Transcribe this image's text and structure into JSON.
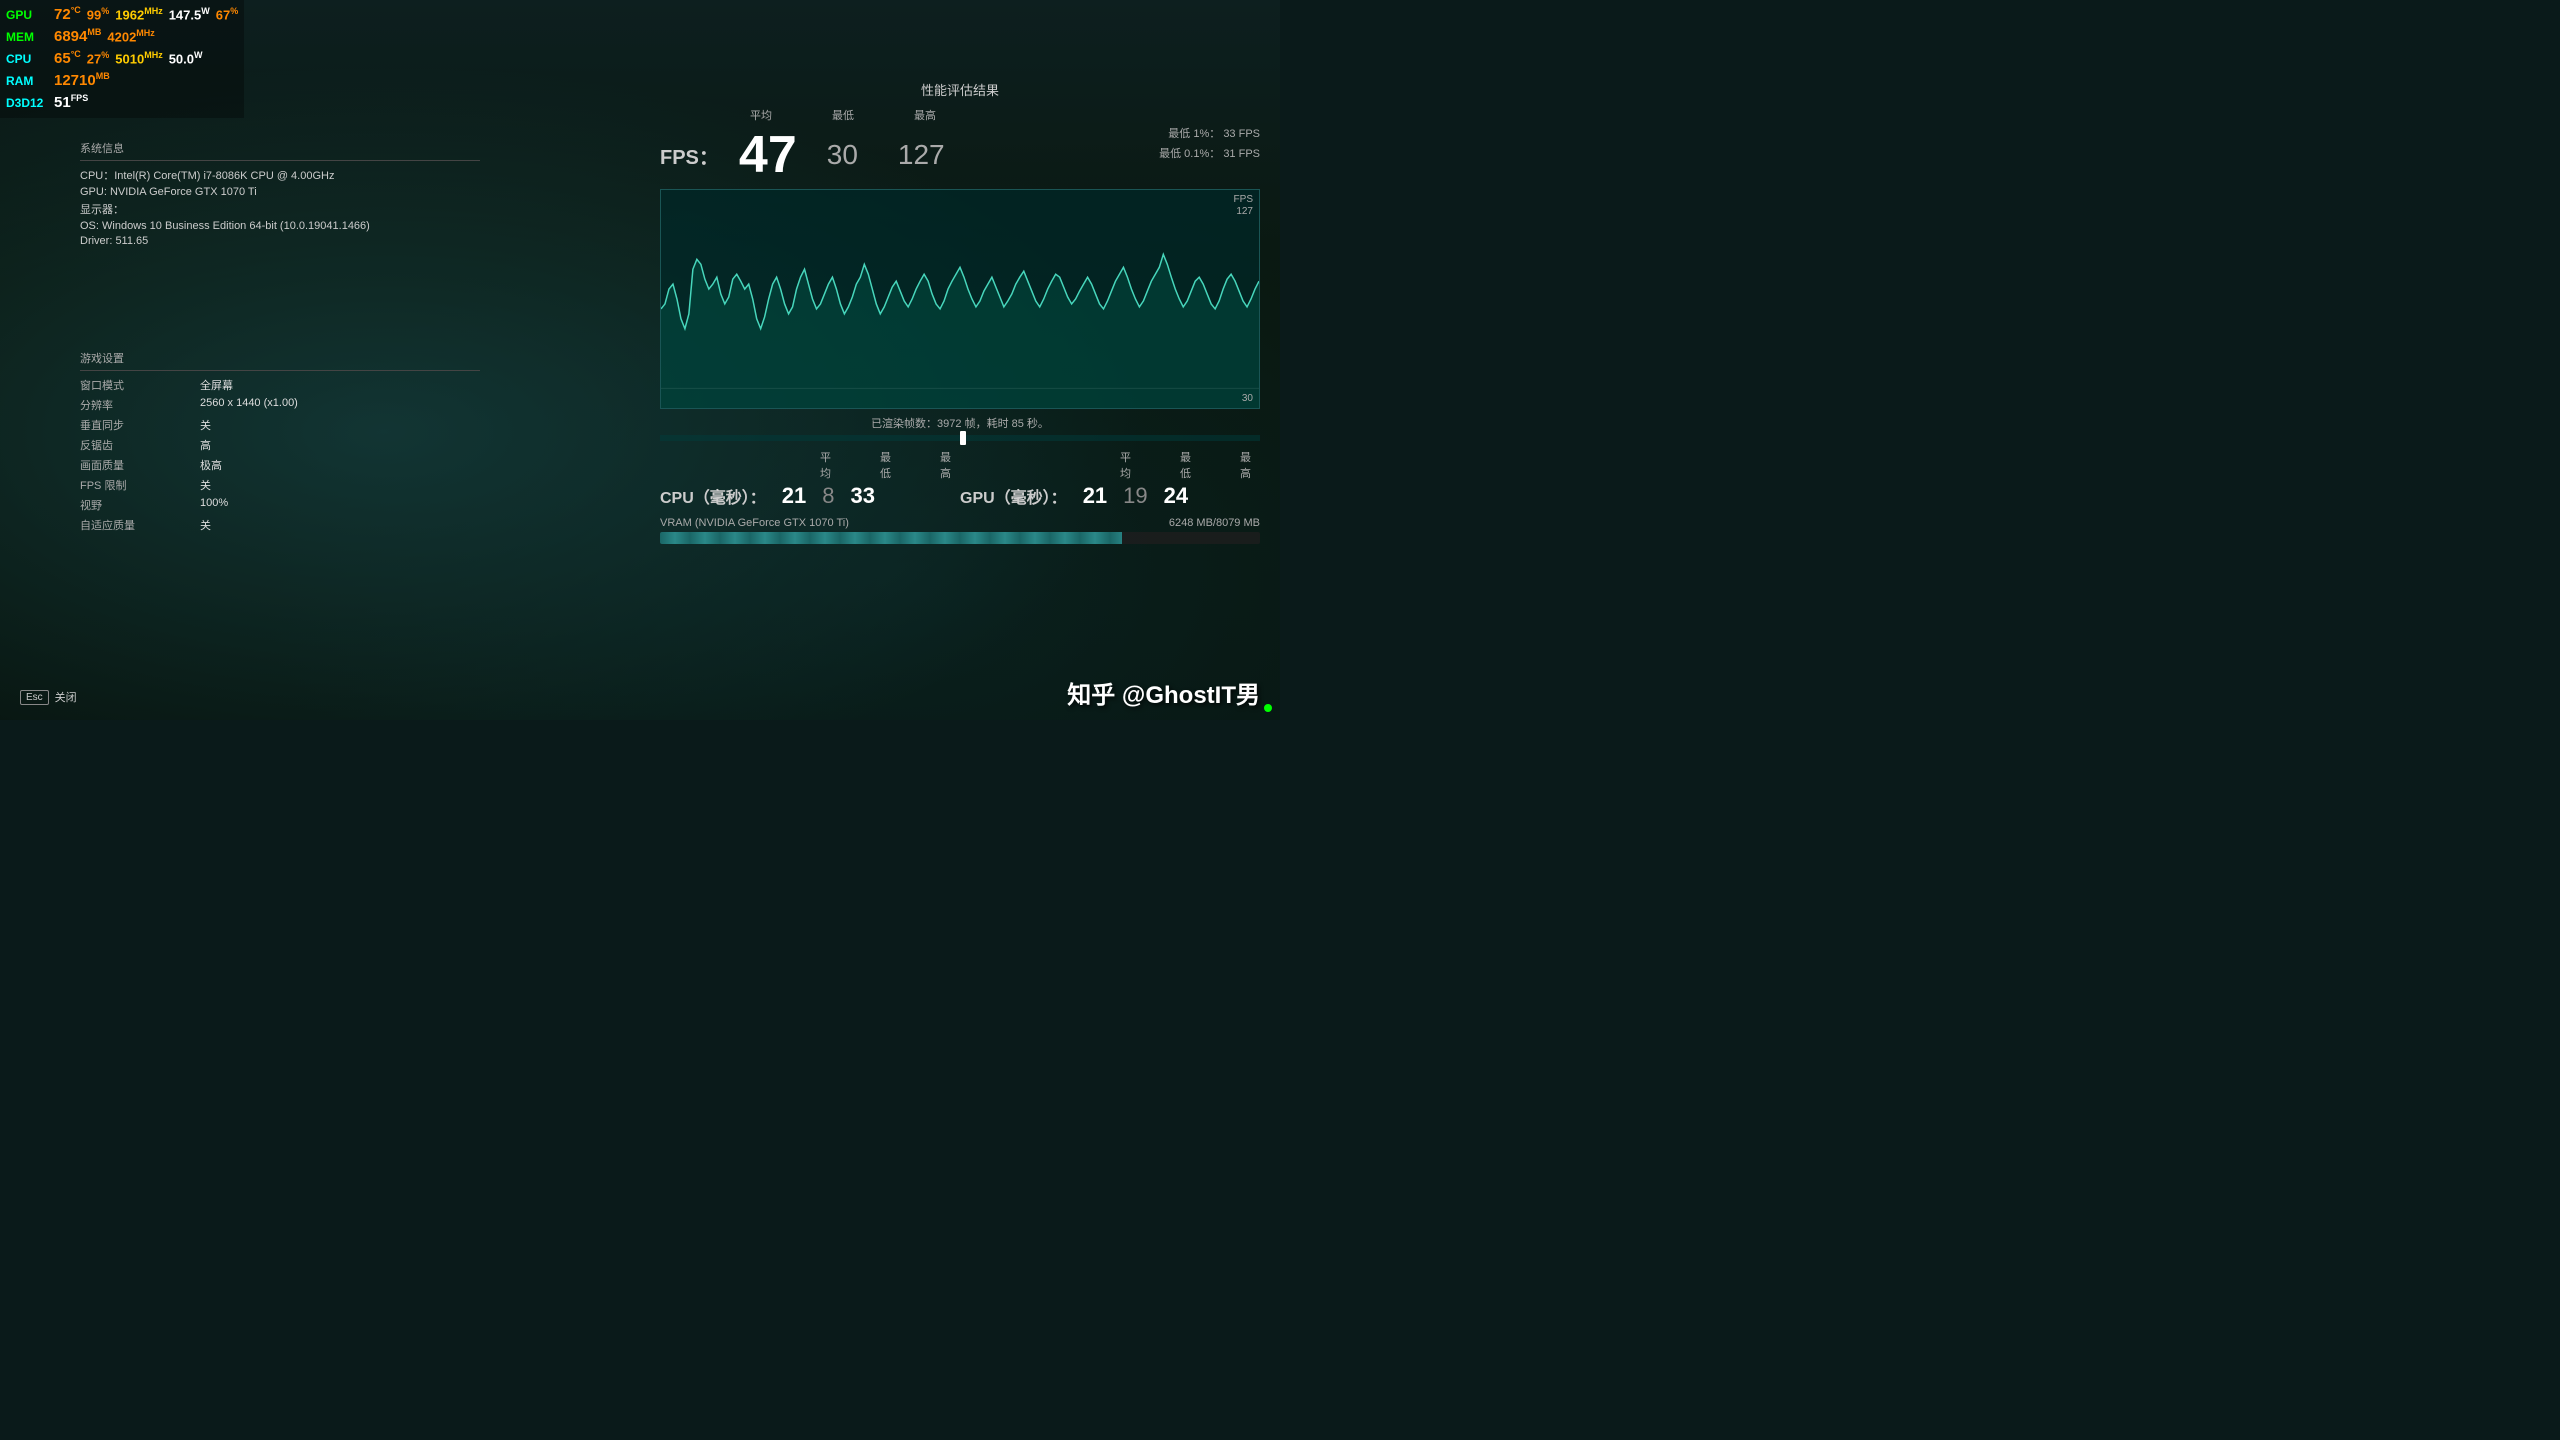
{
  "hw": {
    "gpu_label": "GPU",
    "gpu_temp": "72",
    "gpu_temp_unit": "°C",
    "gpu_load": "99",
    "gpu_load_unit": "%",
    "gpu_clock": "1962",
    "gpu_clock_unit": "MHz",
    "gpu_power": "147.5",
    "gpu_power_unit": "W",
    "gpu_extra": "67",
    "gpu_extra_unit": "%",
    "mem_label": "MEM",
    "mem_value": "6894",
    "mem_unit": "MB",
    "mem_clock": "4202",
    "mem_clock_unit": "MHz",
    "cpu_label": "CPU",
    "cpu_temp": "65",
    "cpu_temp_unit": "°C",
    "cpu_load": "27",
    "cpu_load_unit": "%",
    "cpu_clock": "5010",
    "cpu_clock_unit": "MHz",
    "cpu_power": "50.0",
    "cpu_power_unit": "W",
    "ram_label": "RAM",
    "ram_value": "12710",
    "ram_unit": "MB",
    "d3d_label": "D3D12",
    "d3d_fps": "51",
    "d3d_fps_unit": "FPS"
  },
  "sysinfo": {
    "title": "系统信息",
    "cpu": "CPU：Intel(R) Core(TM) i7-8086K CPU @ 4.00GHz",
    "gpu": "GPU: NVIDIA GeForce GTX 1070 Ti",
    "display": "显示器：",
    "os": "OS: Windows 10 Business Edition 64-bit (10.0.19041.1466)",
    "driver": "Driver: 511.65"
  },
  "gamesettings": {
    "title": "游戏设置",
    "rows": [
      {
        "key": "窗口模式",
        "val": "全屏幕"
      },
      {
        "key": "分辨率",
        "val": "2560 x 1440 (x1.00)"
      },
      {
        "key": "垂直同步",
        "val": "关"
      },
      {
        "key": "反锯齿",
        "val": "高"
      },
      {
        "key": "画面质量",
        "val": "极高"
      },
      {
        "key": "FPS 限制",
        "val": "关"
      },
      {
        "key": "视野",
        "val": "100%"
      },
      {
        "key": "自适应质量",
        "val": "关"
      }
    ]
  },
  "perf": {
    "title": "性能评估结果",
    "fps_label": "FPS：",
    "avg_label": "平均",
    "min_label": "最低",
    "max_label": "最高",
    "fps_avg": "47",
    "fps_min": "30",
    "fps_max": "127",
    "percentile1_label": "最低 1%：",
    "percentile1_val": "33 FPS",
    "percentile01_label": "最低 0.1%：",
    "percentile01_val": "31 FPS",
    "chart_fps_label": "FPS",
    "chart_max_val": "127",
    "chart_min_val": "30",
    "render_info": "已渲染帧数：3972 帧，耗时 85 秒。",
    "cpu_ms_label": "CPU（毫秒）：",
    "cpu_avg": "21",
    "cpu_min": "8",
    "cpu_max": "33",
    "gpu_ms_label": "GPU（毫秒）：",
    "gpu_avg": "21",
    "gpu_min": "19",
    "gpu_max": "24",
    "ms_avg_label": "平均",
    "ms_min_label": "最低",
    "ms_max_label": "最高",
    "vram_label": "VRAM (NVIDIA GeForce GTX 1070 Ti)",
    "vram_usage": "6248 MB/8079 MB",
    "vram_percent": 77
  },
  "footer": {
    "esc_label": "Esc",
    "close_label": "关闭",
    "watermark": "知乎 @GhostIT男"
  }
}
